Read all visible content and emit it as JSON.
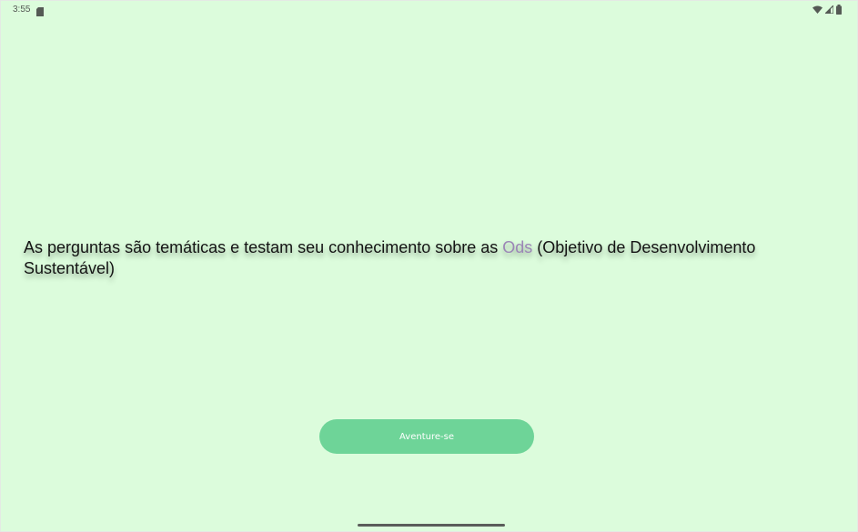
{
  "status_bar": {
    "time": "3:55",
    "icons": [
      "sd-card-icon",
      "wifi-icon",
      "cellular-signal-icon",
      "battery-icon"
    ]
  },
  "intro": {
    "text_before": " As perguntas são temáticas e testam seu conhecimento sobre as ",
    "highlight": "Ods",
    "text_after": " (Objetivo de Desenvolvimento Sustentável)"
  },
  "cta": {
    "label": "Aventure-se"
  },
  "colors": {
    "background": "#dcfcdc",
    "button": "#6ed498",
    "highlight": "#9b86b6"
  }
}
